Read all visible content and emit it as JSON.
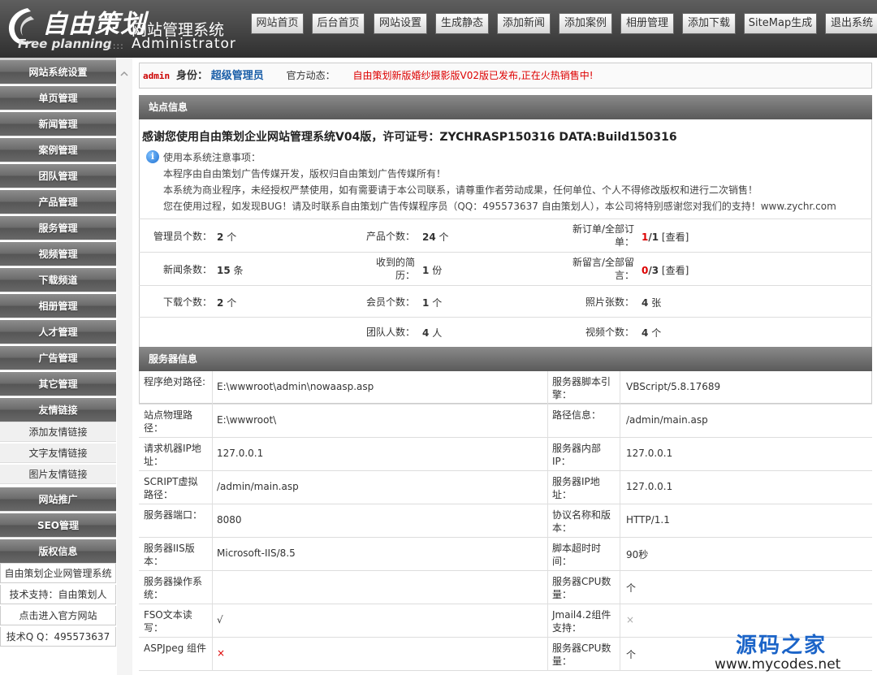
{
  "logo": {
    "cn": "自由策划",
    "en": "Free planning",
    "system_title": "网站管理系统",
    "admin_word": "Administrator"
  },
  "topnav": [
    "网站首页",
    "后台首页",
    "网站设置",
    "生成静态",
    "添加新闻",
    "添加案例",
    "相册管理",
    "添加下载",
    "SiteMap生成",
    "退出系统"
  ],
  "sidebar": {
    "menus": [
      "网站系统设置",
      "单页管理",
      "新闻管理",
      "案例管理",
      "团队管理",
      "产品管理",
      "服务管理",
      "视频管理",
      "下载频道",
      "相册管理",
      "人才管理",
      "广告管理",
      "其它管理",
      "友情链接"
    ],
    "friend_links": [
      "添加友情链接",
      "文字友情链接",
      "图片友情链接"
    ],
    "menus2": [
      "网站推广",
      "SEO管理",
      "版权信息"
    ],
    "copyright": [
      "自由策划企业网管理系统",
      "技术支持：自由策划人",
      "点击进入官方网站",
      "技术Q Q：495573637"
    ]
  },
  "status": {
    "user": "admin",
    "identity_label": "身份：",
    "role": "超级管理员",
    "news_label": "官方动态：",
    "news": "自由策划新版婚纱摄影版V02版已发布,正在火热销售中!"
  },
  "site_info": {
    "title": "站点信息",
    "license": "感谢您使用自由策划企业网站管理系统V04版，许可证号：ZYCHRASP150316 DATA:Build150316",
    "notice": [
      "使用本系统注意事项：",
      "本程序由自由策划广告传媒开发，版权归自由策划广告传媒所有！",
      "本系统为商业程序，未经授权严禁使用，如有需要请于本公司联系，请尊重作者劳动成果，任何单位、个人不得修改版权和进行二次销售！",
      "您在使用过程，如发现BUG！请及时联系自由策划广告传媒程序员（QQ：495573637 自由策划人），本公司将特别感谢您对我们的支持！www.zychr.com"
    ],
    "stats": {
      "admin_count_label": "管理员个数：",
      "admin_count": "2",
      "admin_unit": "个",
      "product_label": "产品个数：",
      "product_count": "24",
      "product_unit": "个",
      "order_label": "新订单/全部订单：",
      "order_new": "1",
      "order_total": "/1",
      "order_view": "[查看]",
      "news_label": "新闻条数：",
      "news_count": "15",
      "news_unit": "条",
      "resume_label": "收到的简历：",
      "resume_count": "1",
      "resume_unit": "份",
      "msg_label": "新留言/全部留言：",
      "msg_new": "0",
      "msg_total": "/3",
      "msg_view": "[查看]",
      "download_label": "下载个数：",
      "download_count": "2",
      "download_unit": "个",
      "member_label": "会员个数：",
      "member_count": "1",
      "member_unit": "个",
      "photo_label": "照片张数：",
      "photo_count": "4",
      "photo_unit": "张",
      "team_label": "团队人数：",
      "team_count": "4",
      "team_unit": "人",
      "video_label": "视频个数：",
      "video_count": "4",
      "video_unit": "个"
    }
  },
  "server_info": {
    "title": "服务器信息",
    "rows": [
      {
        "k1": "程序绝对路径:",
        "v1": "E:\\wwwroot\\admin\\nowaasp.asp",
        "k2": "服务器脚本引擎：",
        "v2": "VBScript/5.8.17689"
      },
      {
        "k1": "站点物理路径：",
        "v1": "E:\\wwwroot\\",
        "k2": "路径信息：",
        "v2": "/admin/main.asp"
      },
      {
        "k1": "请求机器IP地址：",
        "v1": "127.0.0.1",
        "k2": "服务器内部IP：",
        "v2": "127.0.0.1"
      },
      {
        "k1": "SCRIPT虚拟路径：",
        "v1": "/admin/main.asp",
        "k2": "服务器IP地址：",
        "v2": "127.0.0.1"
      },
      {
        "k1": "服务器端口：",
        "v1": "8080",
        "k2": "协议名称和版本：",
        "v2": "HTTP/1.1"
      },
      {
        "k1": "服务器IIS版本：",
        "v1": "Microsoft-IIS/8.5",
        "k2": "脚本超时时间：",
        "v2": "90秒"
      },
      {
        "k1": "服务器操作系统：",
        "v1": "",
        "k2": "服务器CPU数量：",
        "v2": "个"
      },
      {
        "k1": "FSO文本读写：",
        "v1": "√",
        "k2": "Jmail4.2组件支持：",
        "v2": "×"
      },
      {
        "k1": "ASPJpeg 组件",
        "v1": "×",
        "k2": "服务器CPU数量：",
        "v2": "个"
      }
    ]
  },
  "watermark": {
    "cn": "源码之家",
    "url": "www.mycodes.net"
  },
  "colors": {
    "header": "#3e3e3e",
    "accent_red": "#dd0000",
    "role_blue": "#1a5ea8",
    "watermark_blue": "#1b64c8"
  }
}
